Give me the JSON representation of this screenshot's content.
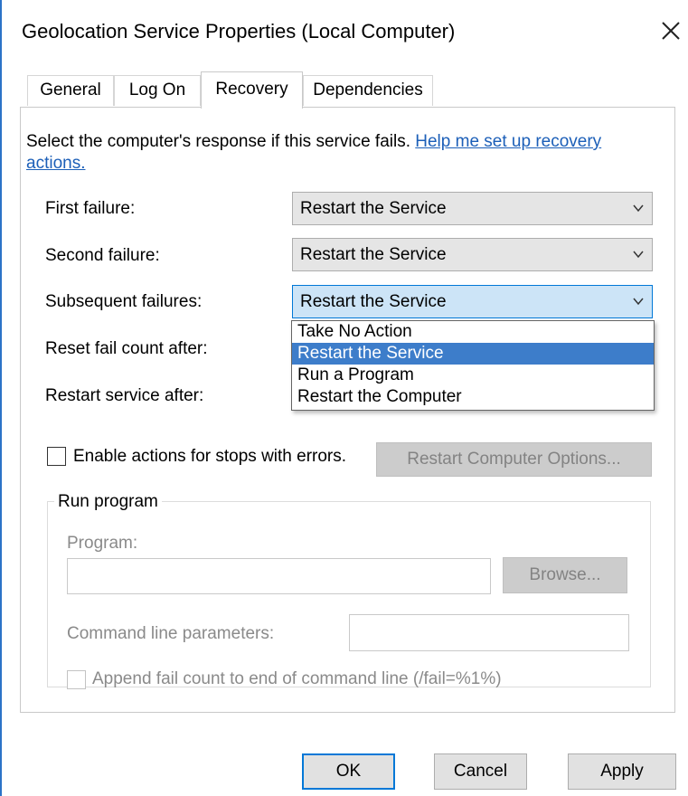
{
  "window": {
    "title": "Geolocation Service Properties (Local Computer)",
    "close_icon": "close-icon"
  },
  "tabs": [
    {
      "label": "General",
      "active": false
    },
    {
      "label": "Log On",
      "active": false
    },
    {
      "label": "Recovery",
      "active": true
    },
    {
      "label": "Dependencies",
      "active": false
    }
  ],
  "recovery": {
    "intro_text": "Select the computer's response if this service fails. ",
    "help_link": "Help me set up recovery actions.",
    "first_failure": {
      "label": "First failure:",
      "value": "Restart the Service"
    },
    "second_failure": {
      "label": "Second failure:",
      "value": "Restart the Service"
    },
    "subsequent_failures": {
      "label": "Subsequent failures:",
      "value": "Restart the Service"
    },
    "dropdown_options": [
      "Take No Action",
      "Restart the Service",
      "Run a Program",
      "Restart the Computer"
    ],
    "dropdown_selected": "Restart the Service",
    "reset_fail_count_label": "Reset fail count after:",
    "restart_service_label": "Restart service after:",
    "enable_actions_label": "Enable actions for stops with errors.",
    "enable_actions_checked": false,
    "restart_computer_options_button": "Restart Computer Options...",
    "run_program": {
      "group_title": "Run program",
      "program_label": "Program:",
      "program_value": "",
      "browse_button": "Browse...",
      "command_line_label": "Command line parameters:",
      "command_line_value": "",
      "append_fail_count_label": "Append fail count to end of command line (/fail=%1%)",
      "append_fail_count_checked": false
    }
  },
  "footer": {
    "ok_button": "OK",
    "cancel_button": "Cancel",
    "apply_button": "Apply"
  },
  "colors": {
    "accent": "#0078d7",
    "selection": "#3d7dca",
    "link": "#1c5fb8",
    "disabled_text": "#8a8a8a"
  }
}
